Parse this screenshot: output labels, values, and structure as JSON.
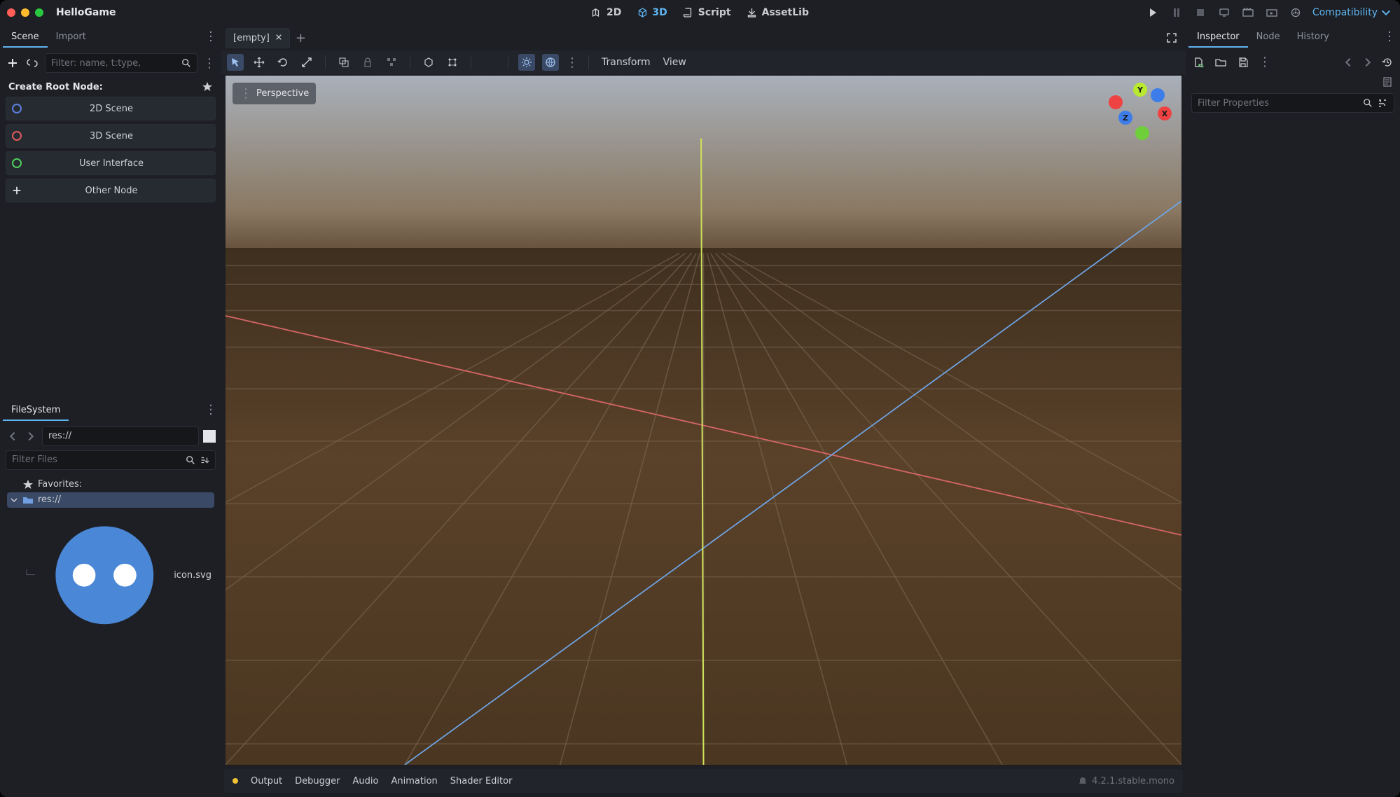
{
  "app_title": "HelloGame",
  "topnav": {
    "d2": "2D",
    "d3": "3D",
    "script": "Script",
    "assetlib": "AssetLib"
  },
  "compat_label": "Compatibility",
  "scene_panel": {
    "tabs": [
      "Scene",
      "Import"
    ],
    "filter_placeholder": "Filter: name, t:type,",
    "create_root": "Create Root Node:",
    "options": {
      "o2d": "2D Scene",
      "o3d": "3D Scene",
      "oui": "User Interface",
      "oother": "Other Node"
    }
  },
  "filesystem": {
    "tab": "FileSystem",
    "path": "res://",
    "filter_placeholder": "Filter Files",
    "favorites": "Favorites:",
    "root": "res://",
    "file": "icon.svg"
  },
  "center": {
    "tab_label": "[empty]",
    "perspective": "Perspective",
    "transform": "Transform",
    "view": "View"
  },
  "gizmo": {
    "x": "X",
    "y": "Y",
    "z": "Z"
  },
  "bottom": {
    "output": "Output",
    "debugger": "Debugger",
    "audio": "Audio",
    "animation": "Animation",
    "shader": "Shader Editor",
    "version": "4.2.1.stable.mono"
  },
  "inspector": {
    "tabs": [
      "Inspector",
      "Node",
      "History"
    ],
    "filter_placeholder": "Filter Properties"
  }
}
